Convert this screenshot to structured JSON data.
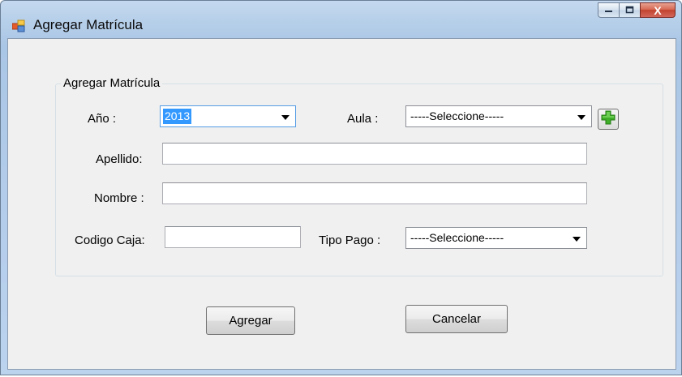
{
  "window": {
    "title": "Agregar Matrícula",
    "close_glyph": "X"
  },
  "group": {
    "legend": "Agregar Matrícula"
  },
  "form": {
    "anio_label": "Año :",
    "anio_value": "2013",
    "aula_label": "Aula :",
    "aula_value": "-----Seleccione-----",
    "apellido_label": "Apellido:",
    "apellido_value": "",
    "nombre_label": "Nombre :",
    "nombre_value": "",
    "codigo_caja_label": "Codigo Caja:",
    "codigo_caja_value": "",
    "tipo_pago_label": "Tipo Pago :",
    "tipo_pago_value": "-----Seleccione-----"
  },
  "buttons": {
    "agregar": "Agregar",
    "cancelar": "Cancelar"
  },
  "icons": {
    "app": "form-window-icon",
    "add": "green-plus-icon",
    "minimize": "minimize-icon",
    "maximize": "maximize-icon",
    "close": "close-icon"
  },
  "colors": {
    "selection": "#3399ff",
    "plus_green": "#3fae29",
    "close_red": "#c2432e"
  }
}
